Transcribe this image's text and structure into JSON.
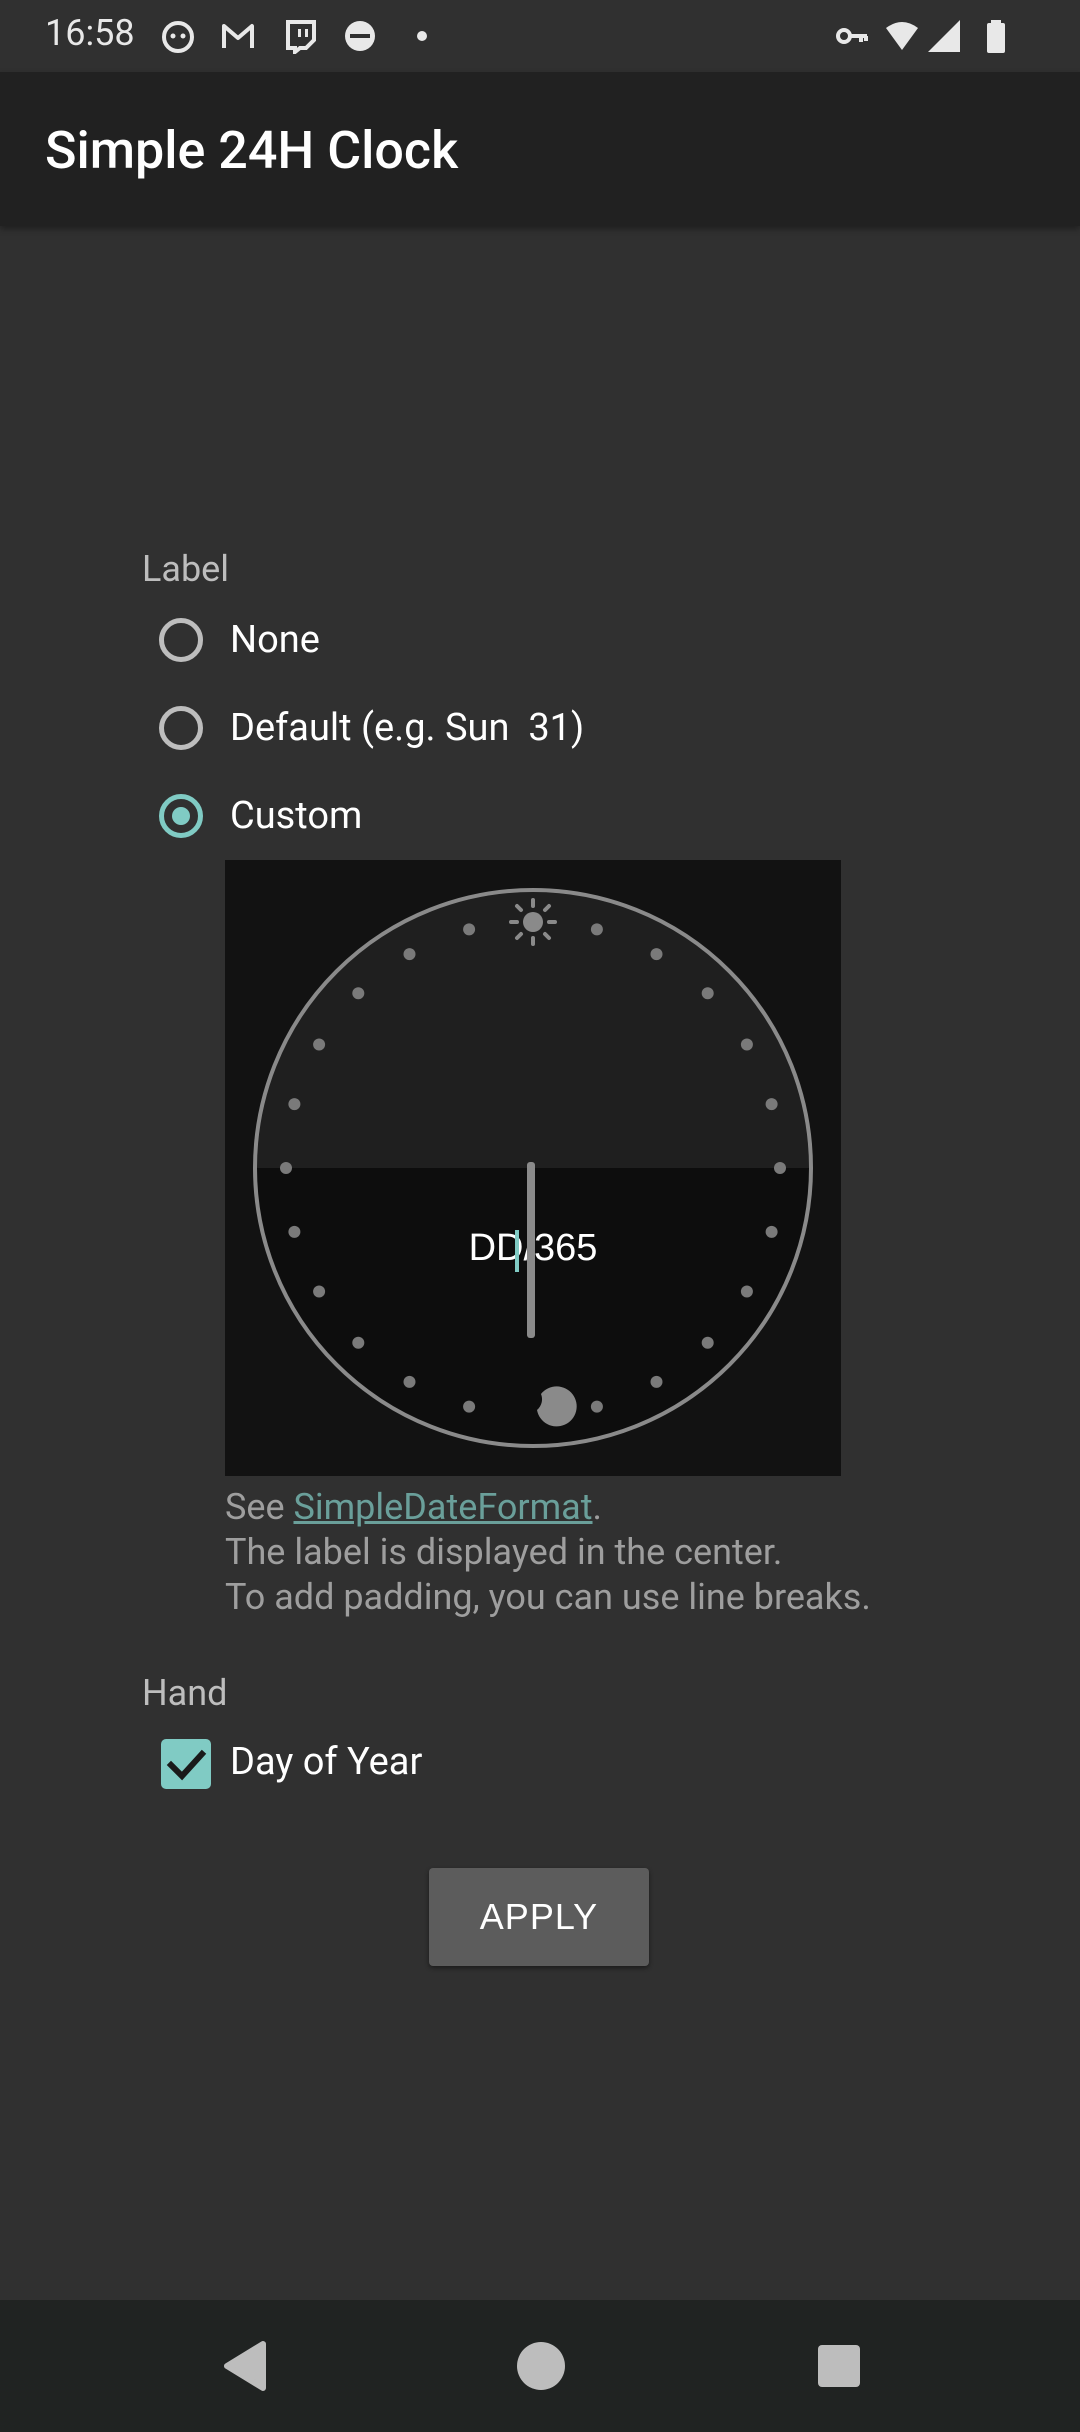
{
  "status_bar": {
    "time": "16:58",
    "left_icons": [
      "cat-face-icon",
      "gmail-icon",
      "twitch-icon",
      "scooter-face-icon",
      "dot-icon"
    ],
    "right_icons": [
      "vpn-key-icon",
      "wifi-icon",
      "signal-icon",
      "battery-icon"
    ]
  },
  "app_bar": {
    "title": "Simple 24H Clock"
  },
  "label_section": {
    "heading": "Label",
    "options": [
      {
        "label": "None",
        "checked": false
      },
      {
        "label": "Default (e.g. Sun  31)",
        "checked": false
      },
      {
        "label": "Custom",
        "checked": true
      }
    ],
    "custom_value": "DD/365"
  },
  "hint": {
    "prefix": "See ",
    "link": "SimpleDateFormat",
    "suffix": ".",
    "line2": "The label is displayed in the center.",
    "line3": "To add padding, you can use line breaks."
  },
  "hand_section": {
    "heading": "Hand",
    "checkbox_label": "Day of Year",
    "checked": true
  },
  "apply_button": {
    "label": "APPLY"
  },
  "nav_bar": {
    "buttons": [
      "back-icon",
      "home-icon",
      "recents-icon"
    ]
  },
  "colors": {
    "accent": "#80cbc4",
    "background": "#303030",
    "app_bar": "#212121",
    "link": "#6a9f9a"
  }
}
